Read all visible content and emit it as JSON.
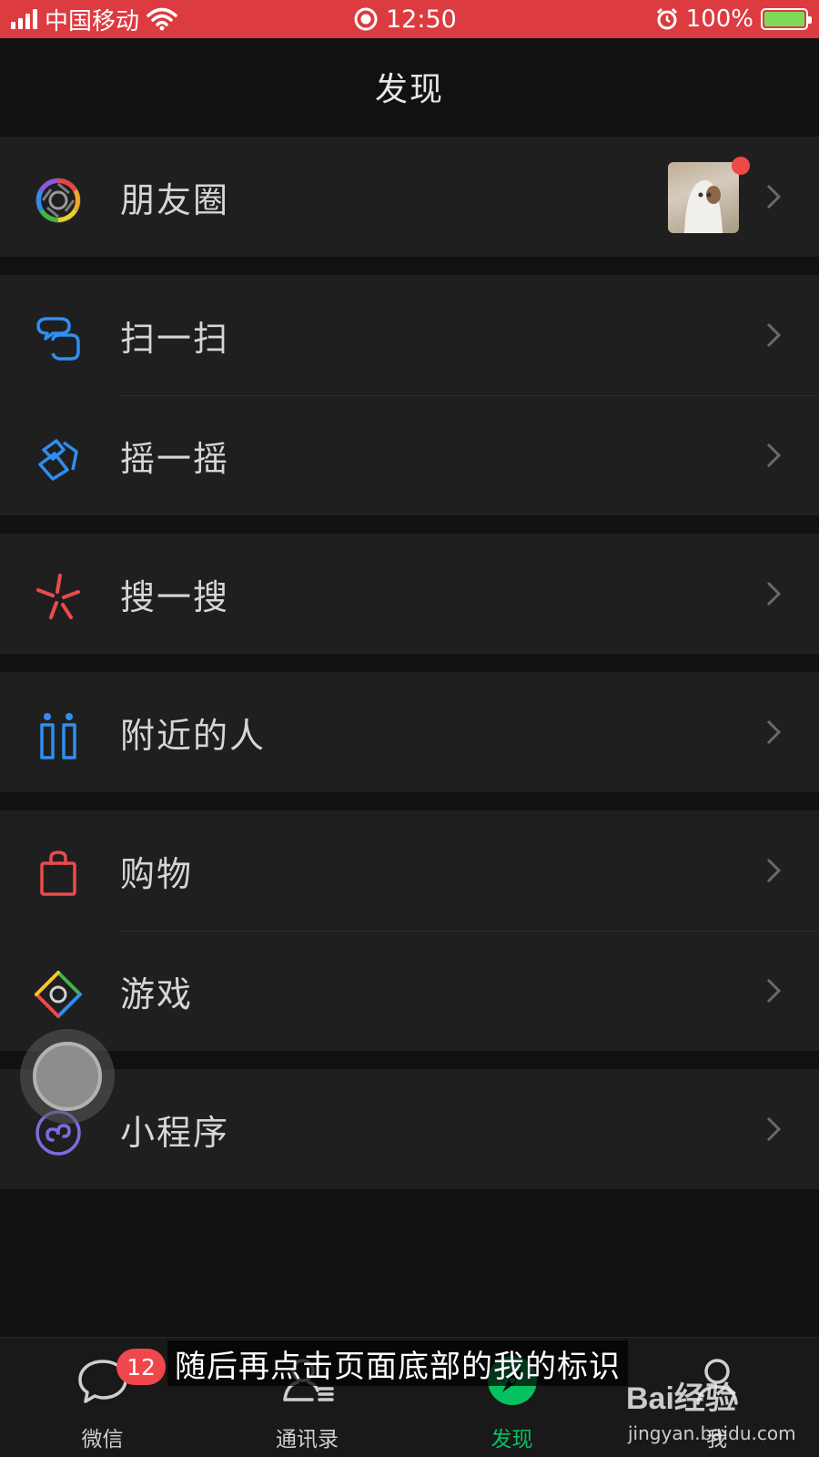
{
  "status_bar": {
    "carrier": "中国移动",
    "time": "12:50",
    "battery": "100%",
    "bg_color": "#dc3b40"
  },
  "header": {
    "title": "发现"
  },
  "menu": {
    "moments": {
      "label": "朋友圈",
      "icon": "moments-aperture-icon",
      "has_new": true
    },
    "scan": {
      "label": "扫一扫",
      "icon": "scan-icon"
    },
    "shake": {
      "label": "摇一摇",
      "icon": "shake-icon"
    },
    "search": {
      "label": "搜一搜",
      "icon": "search-sparkle-icon"
    },
    "nearby": {
      "label": "附近的人",
      "icon": "people-nearby-icon"
    },
    "shopping": {
      "label": "购物",
      "icon": "shopping-bag-icon"
    },
    "games": {
      "label": "游戏",
      "icon": "games-diamond-icon"
    },
    "mini_programs": {
      "label": "小程序",
      "icon": "mini-program-icon"
    }
  },
  "tab_bar": {
    "tabs": [
      {
        "label": "微信",
        "icon": "chat-bubble-icon",
        "badge": "12",
        "active": false
      },
      {
        "label": "通讯录",
        "icon": "contacts-icon",
        "active": false
      },
      {
        "label": "发现",
        "icon": "compass-icon",
        "active": true
      },
      {
        "label": "我",
        "icon": "person-icon",
        "active": false
      }
    ],
    "active_color": "#07c160"
  },
  "overlay": {
    "caption": "随后再点击页面底部的我的标识",
    "watermark_logo": "Bai经验",
    "watermark_url": "jingyan.baidu.com"
  }
}
